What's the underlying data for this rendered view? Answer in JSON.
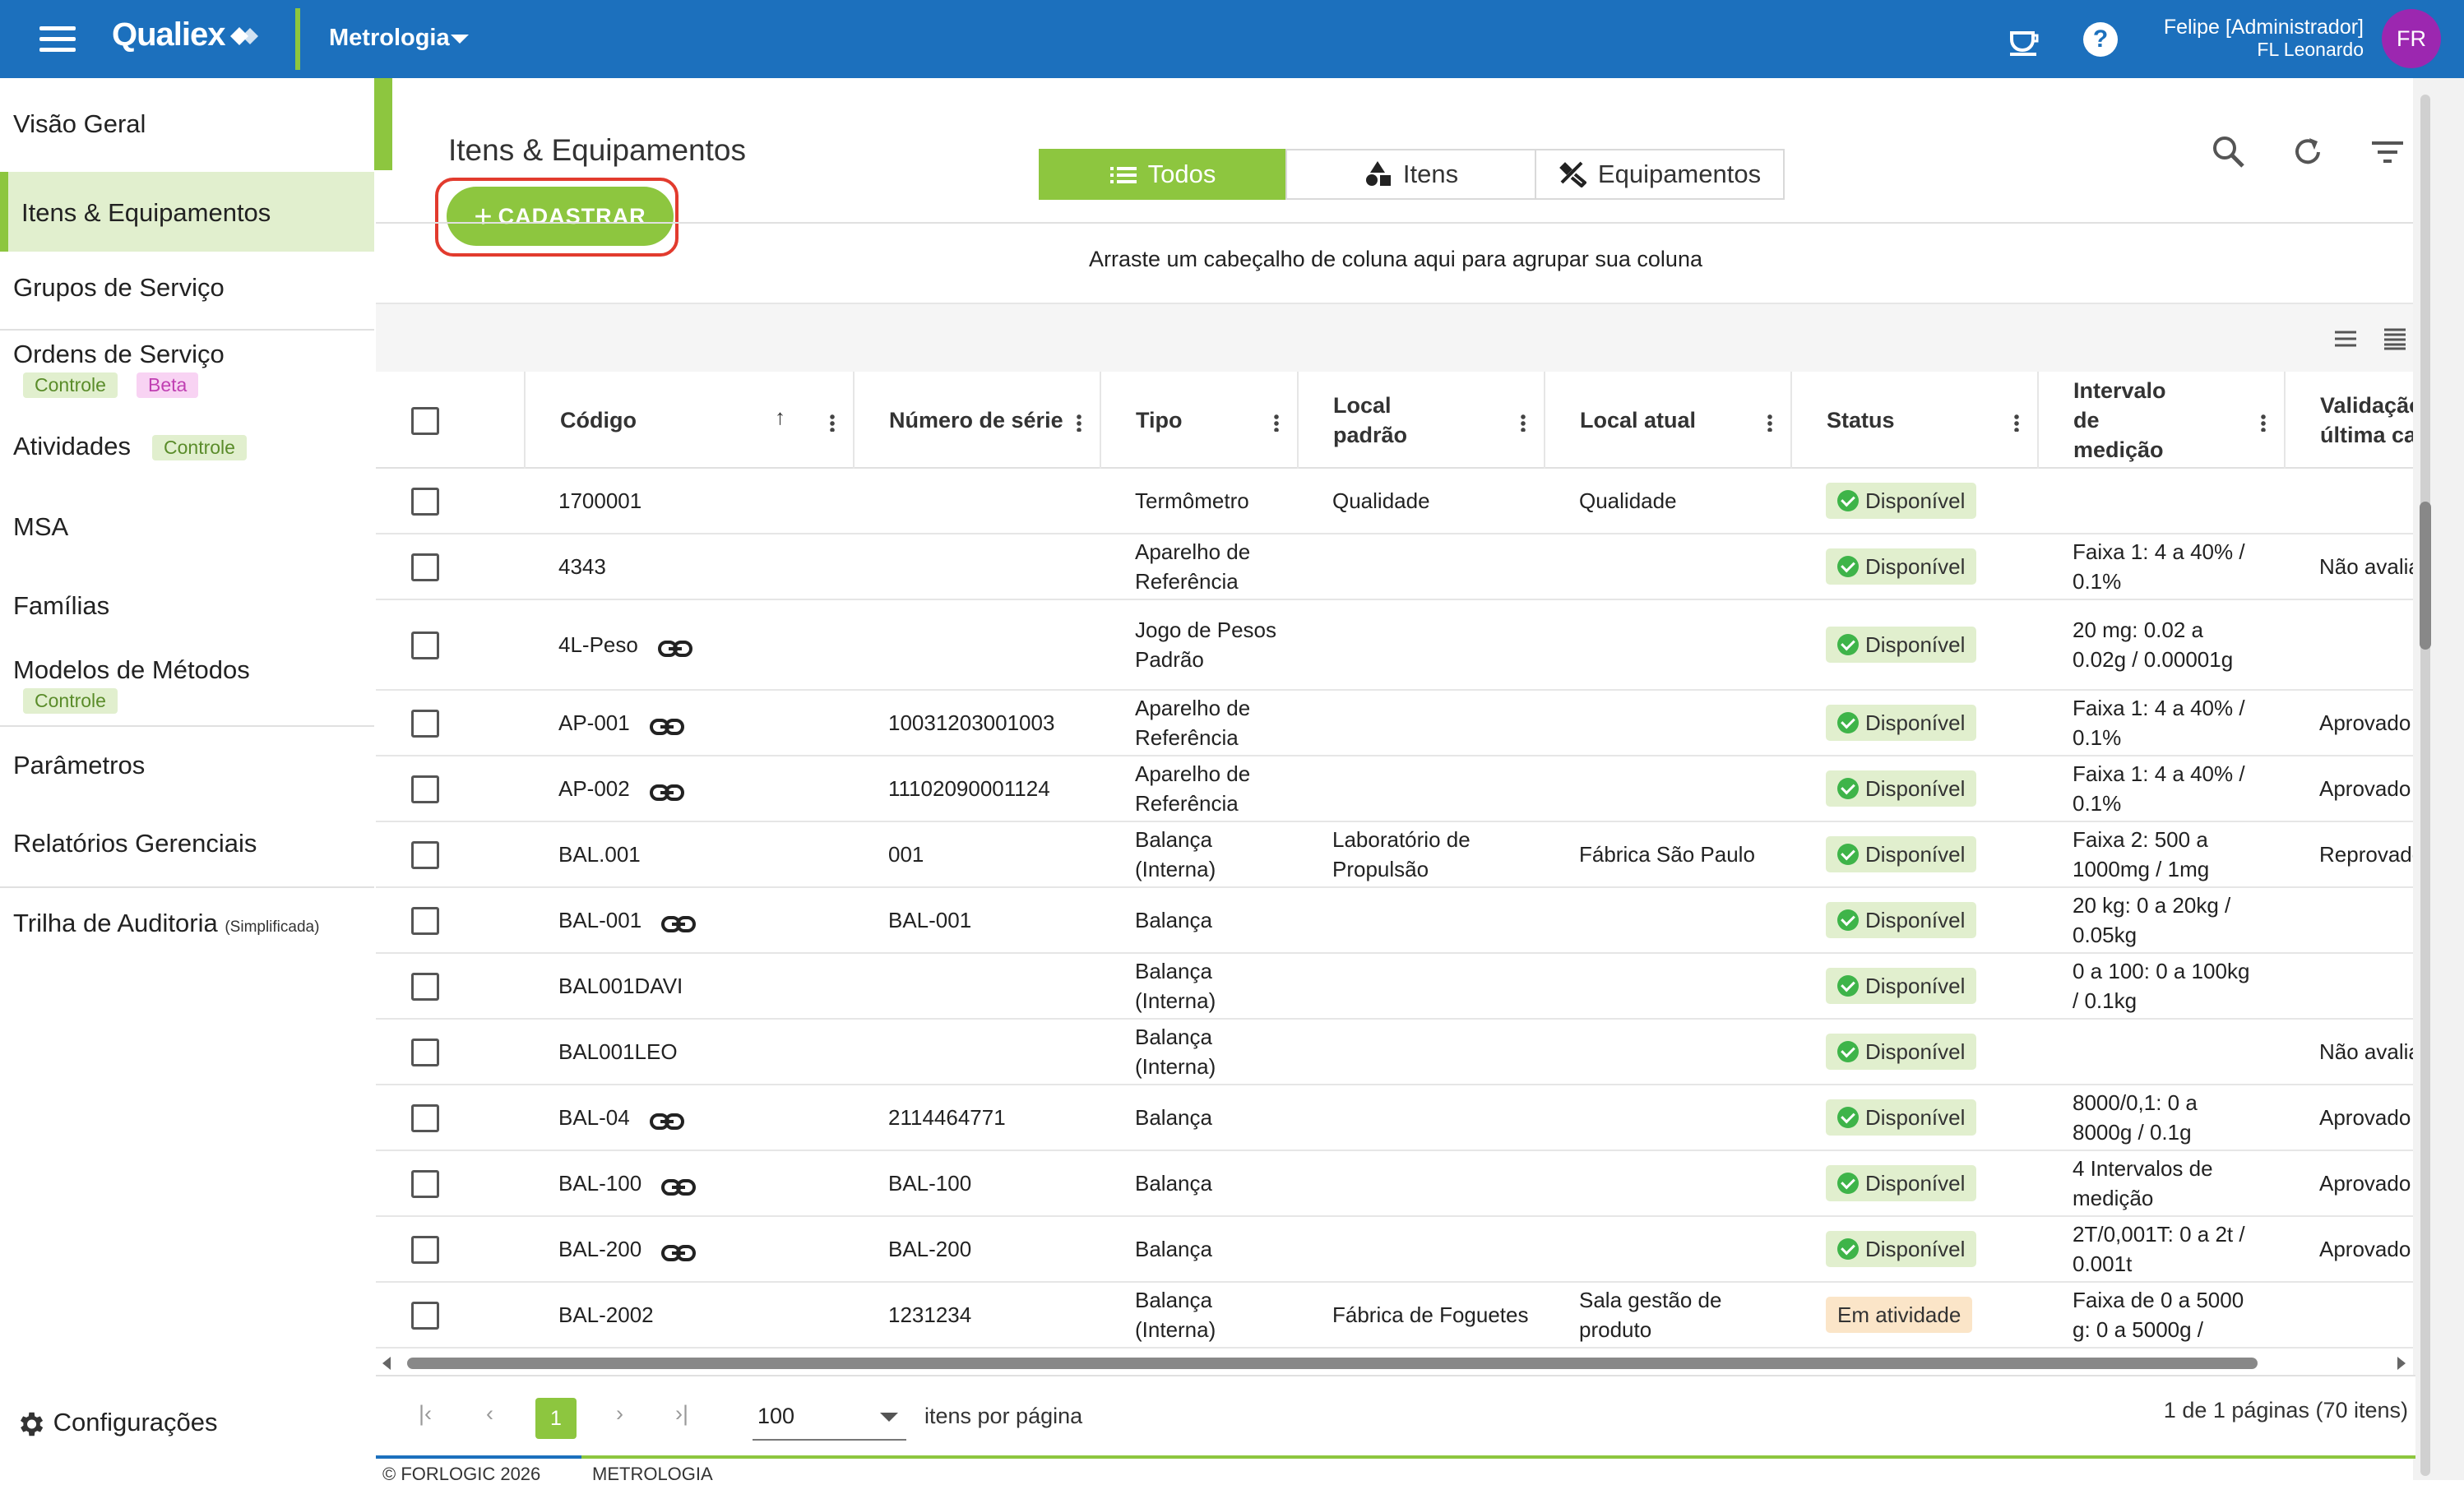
{
  "topbar": {
    "brand": "Qualiex",
    "module": "Metrologia",
    "help": "?",
    "user_name": "Felipe [Administrador]",
    "user_org": "FL Leonardo",
    "avatar_initials": "FR",
    "color": "#1c70bd",
    "accent": "#8dc63f"
  },
  "sidebar": {
    "items": [
      {
        "label": "Visão Geral"
      },
      {
        "label": "Itens & Equipamentos",
        "active": true
      },
      {
        "label": "Grupos de Serviço"
      },
      {
        "label": "Ordens de Serviço",
        "tags": [
          "Controle",
          "Beta"
        ]
      },
      {
        "label": "Atividades",
        "tags": [
          "Controle"
        ]
      },
      {
        "label": "MSA"
      },
      {
        "label": "Famílias"
      },
      {
        "label": "Modelos de Métodos",
        "tags": [
          "Controle"
        ]
      },
      {
        "label": "Parâmetros"
      },
      {
        "label": "Relatórios Gerenciais"
      },
      {
        "label": "Trilha de Auditoria",
        "suffix": "(Simplificada)"
      }
    ],
    "config": "Configurações"
  },
  "page": {
    "title": "Itens & Equipamentos",
    "add_button": "CADASTRAR",
    "tabs": [
      {
        "label": "Todos",
        "icon": "list-icon",
        "selected": true
      },
      {
        "label": "Itens",
        "icon": "shapes-icon"
      },
      {
        "label": "Equipamentos",
        "icon": "tools-icon"
      }
    ],
    "group_hint": "Arraste um cabeçalho de coluna aqui para agrupar sua coluna"
  },
  "table": {
    "columns": [
      "Código",
      "Número de série",
      "Tipo",
      "Local padrão",
      "Local atual",
      "Status",
      "Intervalo de medição",
      "Validação última ca"
    ],
    "rows": [
      {
        "code": "1700001",
        "link": false,
        "serial": "",
        "type": "Termômetro",
        "local": "Qualidade",
        "current": "Qualidade",
        "status": "Disponível",
        "range": "",
        "validation": ""
      },
      {
        "code": "4343",
        "link": false,
        "serial": "",
        "type": "Aparelho de Referência",
        "local": "",
        "current": "",
        "status": "Disponível",
        "range": "Faixa 1: 4 a 40% / 0.1%",
        "validation": "Não avalia"
      },
      {
        "code": "4L-Peso",
        "link": true,
        "serial": "",
        "type": "Jogo de Pesos Padrão",
        "local": "",
        "current": "",
        "status": "Disponível",
        "range": "20 mg: 0.02 a 0.02g / 0.00001g",
        "validation": ""
      },
      {
        "code": "AP-001",
        "link": true,
        "serial": "10031203001003",
        "type": "Aparelho de Referência",
        "local": "",
        "current": "",
        "status": "Disponível",
        "range": "Faixa 1: 4 a 40% / 0.1%",
        "validation": "Aprovado"
      },
      {
        "code": "AP-002",
        "link": true,
        "serial": "11102090001124",
        "type": "Aparelho de Referência",
        "local": "",
        "current": "",
        "status": "Disponível",
        "range": "Faixa 1: 4 a 40% / 0.1%",
        "validation": "Aprovado"
      },
      {
        "code": "BAL.001",
        "link": false,
        "serial": "001",
        "type": "Balança (Interna)",
        "local": "Laboratório de Propulsão",
        "current": "Fábrica São Paulo",
        "status": "Disponível",
        "range": "Faixa 2: 500 a 1000mg / 1mg",
        "validation": "Reprovado"
      },
      {
        "code": "BAL-001",
        "link": true,
        "serial": "BAL-001",
        "type": "Balança",
        "local": "",
        "current": "",
        "status": "Disponível",
        "range": "20 kg: 0 a 20kg / 0.05kg",
        "validation": ""
      },
      {
        "code": "BAL001DAVI",
        "link": false,
        "serial": "",
        "type": "Balança (Interna)",
        "local": "",
        "current": "",
        "status": "Disponível",
        "range": "0 a 100: 0 a 100kg / 0.1kg",
        "validation": ""
      },
      {
        "code": "BAL001LEO",
        "link": false,
        "serial": "",
        "type": "Balança (Interna)",
        "local": "",
        "current": "",
        "status": "Disponível",
        "range": "",
        "validation": "Não avalia"
      },
      {
        "code": "BAL-04",
        "link": true,
        "serial": "2114464771",
        "type": "Balança",
        "local": "",
        "current": "",
        "status": "Disponível",
        "range": "8000/0,1: 0 a 8000g / 0.1g",
        "validation": "Aprovado"
      },
      {
        "code": "BAL-100",
        "link": true,
        "serial": "BAL-100",
        "type": "Balança",
        "local": "",
        "current": "",
        "status": "Disponível",
        "range": "4 Intervalos de medição",
        "validation": "Aprovado"
      },
      {
        "code": "BAL-200",
        "link": true,
        "serial": "BAL-200",
        "type": "Balança",
        "local": "",
        "current": "",
        "status": "Disponível",
        "range": "2T/0,001T: 0 a 2t / 0.001t",
        "validation": "Aprovado"
      },
      {
        "code": "BAL-2002",
        "link": false,
        "serial": "1231234",
        "type": "Balança (Interna)",
        "local": "Fábrica de Foguetes",
        "current": "Sala gestão de produto",
        "status": "Em atividade",
        "range": "Faixa de 0 a 5000 g: 0 a 5000g /",
        "validation": ""
      }
    ]
  },
  "pager": {
    "current": "1",
    "page_size": "100",
    "per_page_label": "itens por página",
    "info": "1 de 1 páginas (70 itens)"
  },
  "footer": {
    "left": "© FORLOGIC 2026",
    "right": "METROLOGIA"
  }
}
